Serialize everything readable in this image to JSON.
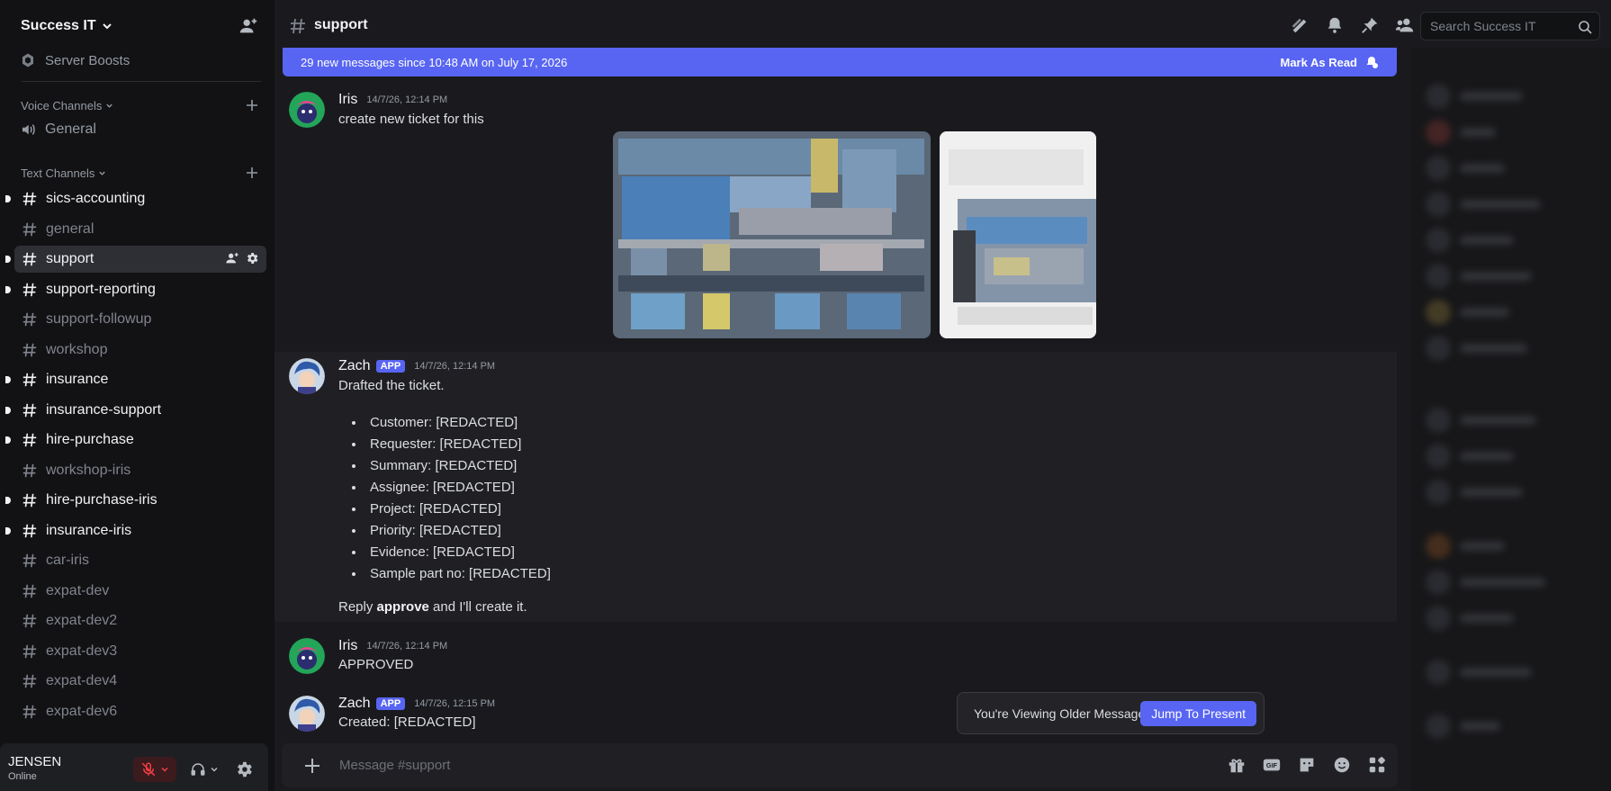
{
  "server": {
    "name": "Success IT"
  },
  "sidebar": {
    "boosts_label": "Server Boosts",
    "voice_category": "Voice Channels",
    "voice_channels": [
      {
        "label": "General"
      }
    ],
    "text_category": "Text Channels",
    "text_channels": [
      {
        "label": "sics-accounting",
        "state": "unread"
      },
      {
        "label": "general",
        "state": "muted"
      },
      {
        "label": "support",
        "state": "active"
      },
      {
        "label": "support-reporting",
        "state": "unread"
      },
      {
        "label": "support-followup",
        "state": "muted"
      },
      {
        "label": "workshop",
        "state": "muted"
      },
      {
        "label": "insurance",
        "state": "unread"
      },
      {
        "label": "insurance-support",
        "state": "unread"
      },
      {
        "label": "hire-purchase",
        "state": "unread"
      },
      {
        "label": "workshop-iris",
        "state": "muted"
      },
      {
        "label": "hire-purchase-iris",
        "state": "unread"
      },
      {
        "label": "insurance-iris",
        "state": "unread"
      },
      {
        "label": "car-iris",
        "state": "muted"
      },
      {
        "label": "expat-dev",
        "state": "muted"
      },
      {
        "label": "expat-dev2",
        "state": "muted"
      },
      {
        "label": "expat-dev3",
        "state": "muted"
      },
      {
        "label": "expat-dev4",
        "state": "muted"
      },
      {
        "label": "expat-dev6",
        "state": "muted"
      }
    ]
  },
  "user": {
    "name": "JENSEN",
    "status": "Online"
  },
  "channel": {
    "name": "support",
    "search_placeholder": "Search Success IT"
  },
  "new_messages_bar": {
    "text": "29 new messages since 10:48 AM on July 17, 2026",
    "action": "Mark As Read"
  },
  "messages": [
    {
      "author": "Iris",
      "timestamp": "14/7/26, 12:14 PM",
      "text": "create new ticket for this"
    },
    {
      "author": "Zach",
      "badge": "APP",
      "timestamp": "14/7/26, 12:14 PM",
      "text": "Drafted the ticket.",
      "items": [
        "Customer: [REDACTED]",
        "Requester: [REDACTED]",
        "Summary: [REDACTED]",
        "Assignee: [REDACTED]",
        "Project: [REDACTED]",
        "Priority: [REDACTED]",
        "Evidence: [REDACTED]",
        "Sample part no: [REDACTED]"
      ],
      "reply_prefix": "Reply ",
      "reply_bold": "approve",
      "reply_suffix": " and I'll create it."
    },
    {
      "author": "Iris",
      "timestamp": "14/7/26, 12:14 PM",
      "text": "APPROVED"
    },
    {
      "author": "Zach",
      "badge": "APP",
      "timestamp": "14/7/26, 12:15 PM",
      "text": "Created: [REDACTED]"
    }
  ],
  "older_banner": {
    "text": "You're Viewing Older Messages",
    "button": "Jump To Present"
  },
  "composer": {
    "placeholder": "Message #support"
  },
  "colors": {
    "accent": "#5865f2",
    "danger": "#f23f43",
    "background": "#1a1a1e",
    "sidebar": "#121214"
  }
}
